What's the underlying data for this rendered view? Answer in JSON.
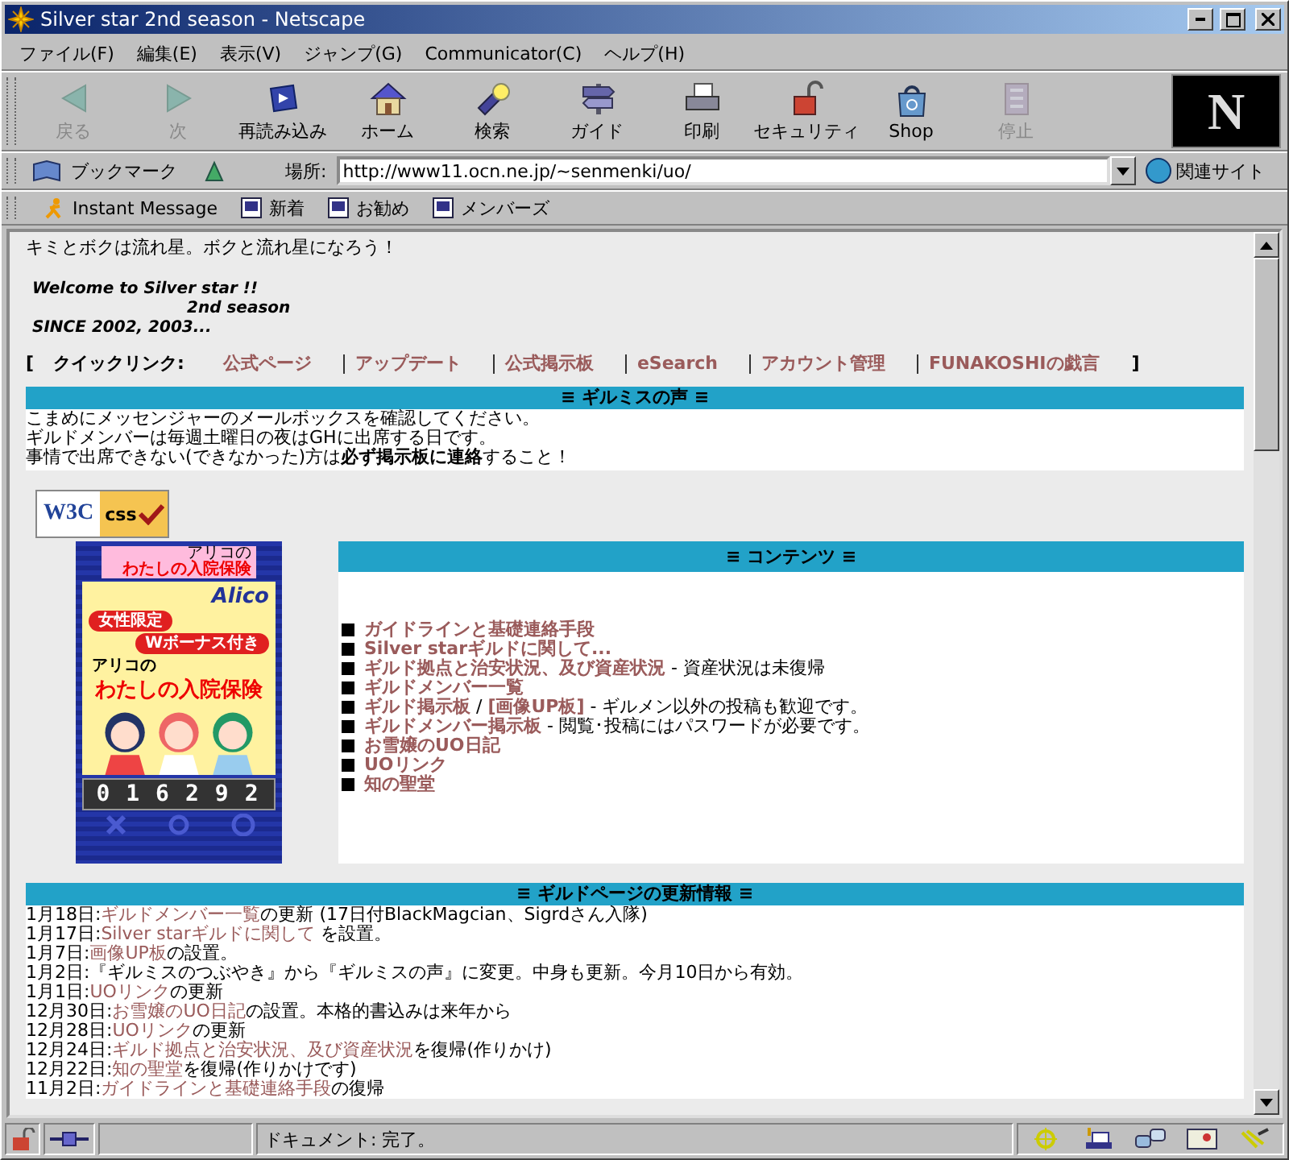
{
  "window": {
    "title": "Silver star 2nd season - Netscape"
  },
  "menu": [
    "ファイル(F)",
    "編集(E)",
    "表示(V)",
    "ジャンプ(G)",
    "Communicator(C)",
    "ヘルプ(H)"
  ],
  "toolbar": [
    {
      "label": "戻る",
      "disabled": true
    },
    {
      "label": "次",
      "disabled": true
    },
    {
      "label": "再読み込み",
      "disabled": false
    },
    {
      "label": "ホーム",
      "disabled": false
    },
    {
      "label": "検索",
      "disabled": false
    },
    {
      "label": "ガイド",
      "disabled": false
    },
    {
      "label": "印刷",
      "disabled": false
    },
    {
      "label": "セキュリティ",
      "disabled": false
    },
    {
      "label": "Shop",
      "disabled": false
    },
    {
      "label": "停止",
      "disabled": true
    }
  ],
  "logo": "N",
  "location_bar": {
    "bookmarks": "ブックマーク",
    "label": "場所:",
    "url": "http://www11.ocn.ne.jp/~senmenki/uo/",
    "related": "関連サイト"
  },
  "personal_toolbar": [
    "Instant Message",
    "新着",
    "お勧め",
    "メンバーズ"
  ],
  "page": {
    "intro": "キミとボクは流れ星。ボクと流れ星になろう！",
    "welcome": [
      "Welcome to Silver star !!",
      "2nd season",
      "SINCE 2002, 2003..."
    ],
    "quick_links": {
      "open": "[",
      "label": "クイックリンク:",
      "links": [
        "公式ページ",
        "アップデート",
        "公式掲示板",
        "eSearch",
        "アカウント管理",
        "FUNAKOSHIの戯言"
      ],
      "close": "]"
    },
    "voice": {
      "title": "≡ ギルミスの声 ≡",
      "lines": [
        "こまめにメッセンジャーのメールボックスを確認してください。",
        "ギルドメンバーは毎週土曜日の夜はGHに出席する日です。",
        "事情で出席できない(できなかった)方は**必ず掲示板に連絡**すること！"
      ]
    },
    "badge": {
      "left": "W3C",
      "right": "css"
    },
    "banner": {
      "top_small": "アリコの",
      "top_title": "わたしの入院保険",
      "brand": "Alico",
      "tag": "女性限定",
      "bonus": "Wボーナス付き",
      "small": "アリコの",
      "title": "わたしの入院保険",
      "counter": "016292"
    },
    "contents": {
      "title": "≡ コンテンツ ≡",
      "items": [
        {
          "parts": [
            {
              "kind": "link",
              "text": "ガイドラインと基礎連絡手段"
            }
          ]
        },
        {
          "parts": [
            {
              "kind": "link",
              "text": "Silver starギルドに関して..."
            }
          ]
        },
        {
          "parts": [
            {
              "kind": "link",
              "text": "ギルド拠点と治安状況、及び資産状況"
            },
            {
              "kind": "text",
              "text": " - 資産状況は未復帰"
            }
          ]
        },
        {
          "parts": [
            {
              "kind": "link",
              "text": "ギルドメンバー一覧"
            }
          ]
        },
        {
          "parts": [
            {
              "kind": "link",
              "text": "ギルド掲示板"
            },
            {
              "kind": "text",
              "text": " / "
            },
            {
              "kind": "link",
              "text": "[画像UP板]"
            },
            {
              "kind": "text",
              "text": " - ギルメン以外の投稿も歓迎です。"
            }
          ]
        },
        {
          "parts": [
            {
              "kind": "link",
              "text": "ギルドメンバー掲示板"
            },
            {
              "kind": "text",
              "text": " - 閲覧･投稿にはパスワードが必要です。"
            }
          ]
        },
        {
          "parts": [
            {
              "kind": "link",
              "text": "お雪嬢のUO日記"
            }
          ]
        },
        {
          "parts": [
            {
              "kind": "link",
              "text": "UOリンク"
            }
          ]
        },
        {
          "parts": [
            {
              "kind": "link",
              "text": "知の聖堂"
            }
          ]
        }
      ]
    },
    "updates": {
      "title": "≡ ギルドページの更新情報 ≡",
      "entries": [
        {
          "date": "1月18日:",
          "parts": [
            {
              "kind": "link",
              "text": "ギルドメンバー一覧"
            },
            {
              "kind": "text",
              "text": "の更新 (17日付BlackMagcian、Sigrdさん入隊)"
            }
          ]
        },
        {
          "date": "1月17日:",
          "parts": [
            {
              "kind": "link",
              "text": "Silver starギルドに関して"
            },
            {
              "kind": "text",
              "text": " を設置。"
            }
          ]
        },
        {
          "date": "1月7日:",
          "parts": [
            {
              "kind": "link",
              "text": "画像UP板"
            },
            {
              "kind": "text",
              "text": "の設置。"
            }
          ]
        },
        {
          "date": "1月2日:",
          "parts": [
            {
              "kind": "text",
              "text": "『ギルミスのつぶやき』から『ギルミスの声』に変更。中身も更新。今月10日から有効。"
            }
          ]
        },
        {
          "date": "1月1日:",
          "parts": [
            {
              "kind": "link",
              "text": "UOリンク"
            },
            {
              "kind": "text",
              "text": "の更新"
            }
          ]
        },
        {
          "date": "12月30日:",
          "parts": [
            {
              "kind": "link",
              "text": "お雪嬢のUO日記"
            },
            {
              "kind": "text",
              "text": "の設置。本格的書込みは来年から"
            }
          ]
        },
        {
          "date": "12月28日:",
          "parts": [
            {
              "kind": "link",
              "text": "UOリンク"
            },
            {
              "kind": "text",
              "text": "の更新"
            }
          ]
        },
        {
          "date": "12月24日:",
          "parts": [
            {
              "kind": "link",
              "text": "ギルド拠点と治安状況、及び資産状況"
            },
            {
              "kind": "text",
              "text": "を復帰(作りかけ)"
            }
          ]
        },
        {
          "date": "12月22日:",
          "parts": [
            {
              "kind": "link",
              "text": "知の聖堂"
            },
            {
              "kind": "text",
              "text": "を復帰(作りかけです)"
            }
          ]
        },
        {
          "date": "11月2日:",
          "parts": [
            {
              "kind": "link",
              "text": "ガイドラインと基礎連絡手段"
            },
            {
              "kind": "text",
              "text": "の復帰"
            }
          ]
        }
      ]
    }
  },
  "status_bar": {
    "text": "ドキュメント: 完了。"
  }
}
